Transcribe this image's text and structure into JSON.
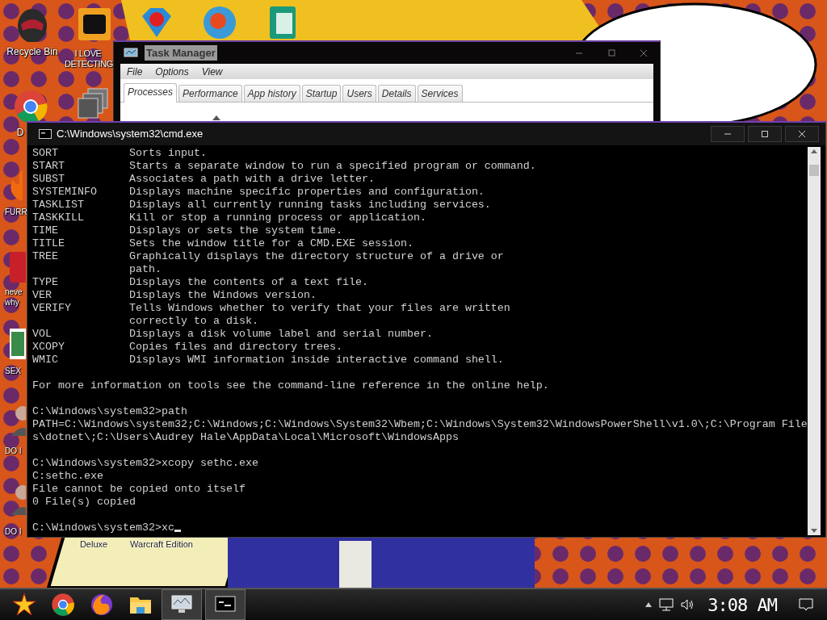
{
  "desktop_icons": [
    {
      "kind": "helmet",
      "label": "Recycle Bin"
    },
    {
      "kind": "gold-tile",
      "label": "I LOVE DETECTING"
    },
    {
      "kind": "gem"
    },
    {
      "kind": "disc"
    },
    {
      "kind": "doc"
    },
    {
      "kind": "browser",
      "label": "D"
    },
    {
      "kind": "stack"
    },
    {
      "kind": "flame",
      "label": "FURR"
    },
    {
      "kind": "red-tile",
      "label": "neve why"
    },
    {
      "kind": "green-tile",
      "label": "SEX"
    },
    {
      "kind": "figure",
      "label": "DO I"
    },
    {
      "kind": "figure",
      "label": "DO I"
    },
    {
      "kind": "hidden",
      "label": "Deluxe"
    },
    {
      "kind": "hidden",
      "label": "Warcraft Edition"
    }
  ],
  "task_manager": {
    "title": "Task Manager",
    "menu": [
      "File",
      "Options",
      "View"
    ],
    "tabs": [
      {
        "label": "Processes",
        "selected": true
      },
      {
        "label": "Performance",
        "selected": false
      },
      {
        "label": "App history",
        "selected": false
      },
      {
        "label": "Startup",
        "selected": false
      },
      {
        "label": "Users",
        "selected": false
      },
      {
        "label": "Details",
        "selected": false
      },
      {
        "label": "Services",
        "selected": false
      }
    ]
  },
  "console": {
    "title": "C:\\Windows\\system32\\cmd.exe",
    "blocks": [
      [
        "SORT           Sorts input.",
        "START          Starts a separate window to run a specified program or command.",
        "SUBST          Associates a path with a drive letter.",
        "SYSTEMINFO     Displays machine specific properties and configuration.",
        "TASKLIST       Displays all currently running tasks including services.",
        "TASKKILL       Kill or stop a running process or application.",
        "TIME           Displays or sets the system time.",
        "TITLE          Sets the window title for a CMD.EXE session.",
        "TREE           Graphically displays the directory structure of a drive or",
        "               path.",
        "TYPE           Displays the contents of a text file.",
        "VER            Displays the Windows version.",
        "VERIFY         Tells Windows whether to verify that your files are written",
        "               correctly to a disk.",
        "VOL            Displays a disk volume label and serial number.",
        "XCOPY          Copies files and directory trees.",
        "WMIC           Displays WMI information inside interactive command shell."
      ],
      [
        "For more information on tools see the command-line reference in the online help."
      ],
      [
        "C:\\Windows\\system32>path",
        "PATH=C:\\Windows\\system32;C:\\Windows;C:\\Windows\\System32\\Wbem;C:\\Windows\\System32\\WindowsPowerShell\\v1.0\\;C:\\Program File",
        "s\\dotnet\\;C:\\Users\\Audrey Hale\\AppData\\Local\\Microsoft\\WindowsApps"
      ],
      [
        "C:\\Windows\\system32>xcopy sethc.exe",
        "C:sethc.exe",
        "File cannot be copied onto itself",
        "0 File(s) copied"
      ],
      [
        "C:\\Windows\\system32>xc"
      ]
    ]
  },
  "taskbar": {
    "apps": [
      {
        "kind": "star"
      },
      {
        "kind": "browser"
      },
      {
        "kind": "fox"
      },
      {
        "kind": "folder"
      },
      {
        "kind": "monitor"
      },
      {
        "kind": "console"
      }
    ],
    "clock": "3:08 AM"
  }
}
